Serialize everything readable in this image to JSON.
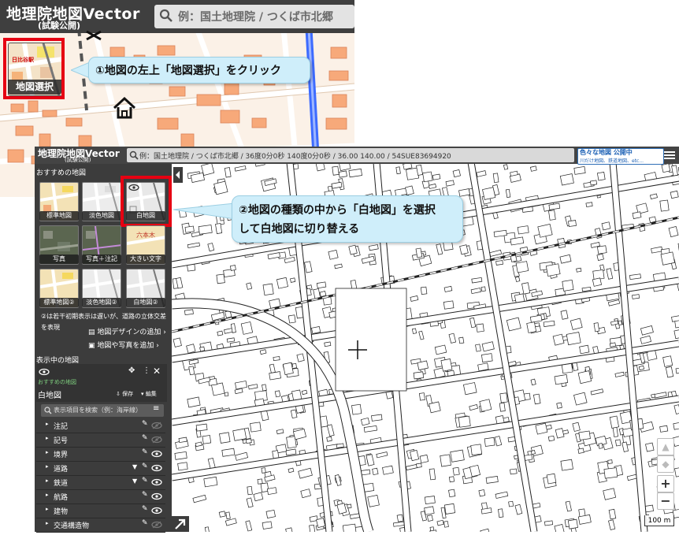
{
  "step1": {
    "app_title": "地理院地図Vector",
    "app_subtitle": "(試験公開)",
    "search_placeholder": "例：国土地理院 / つくば市北郷",
    "map_select_label": "地図選択",
    "callout": "①地図の左上「地図選択」をクリック",
    "thumb_station_label": "日比谷駅"
  },
  "step2": {
    "app_title": "地理院地図Vector",
    "app_subtitle": "(試験公開)",
    "search_text": "例：国土地理院 / つくば市北郷 / 36度0分0秒 140度0分0秒 / 36.00 140.00 / 54SUE83694920",
    "badge_title": "色々な地図 公開中",
    "badge_sub": "川だけ地図、鉄道地図、etc...",
    "recommended_heading": "おすすめの地図",
    "thumbnails": [
      {
        "label": "標準地図"
      },
      {
        "label": "淡色地図"
      },
      {
        "label": "白地図"
      },
      {
        "label": "写真"
      },
      {
        "label": "写真＋注記"
      },
      {
        "label": "大きい文字"
      },
      {
        "label": "標準地図②"
      },
      {
        "label": "淡色地図②"
      },
      {
        "label": "白地図②"
      }
    ],
    "note_line1": "②は若干初期表示は遅いが、道路の立体交差",
    "note_line2": "を表現",
    "add_design": "地図デザインの追加",
    "add_photo": "地図や写真を追加",
    "showing_heading": "表示中の地図",
    "showing_tag": "おすすめの地図",
    "current_map": "白地図",
    "save_label": "保存",
    "edit_label": "編集",
    "layer_search_placeholder": "表示項目を検索（例：海岸線）",
    "layers": [
      {
        "label": "注記",
        "visible": false
      },
      {
        "label": "記号",
        "visible": false
      },
      {
        "label": "境界",
        "visible": true
      },
      {
        "label": "道路",
        "visible": true
      },
      {
        "label": "鉄道",
        "visible": true
      },
      {
        "label": "航路",
        "visible": true
      },
      {
        "label": "建物",
        "visible": true
      },
      {
        "label": "交通構造物",
        "visible": false
      }
    ],
    "callout_line1": "②地図の種類の中から「白地図」を選択",
    "callout_line2": "して白地図に切り替える",
    "zoom_in": "+",
    "zoom_out": "−",
    "scale_label": "100 m"
  },
  "colors": {
    "highlight": "#e60012",
    "callout_bg": "#cfeefa",
    "header_bg": "#3f3f3f",
    "panel_bg": "#3c3c3c"
  }
}
